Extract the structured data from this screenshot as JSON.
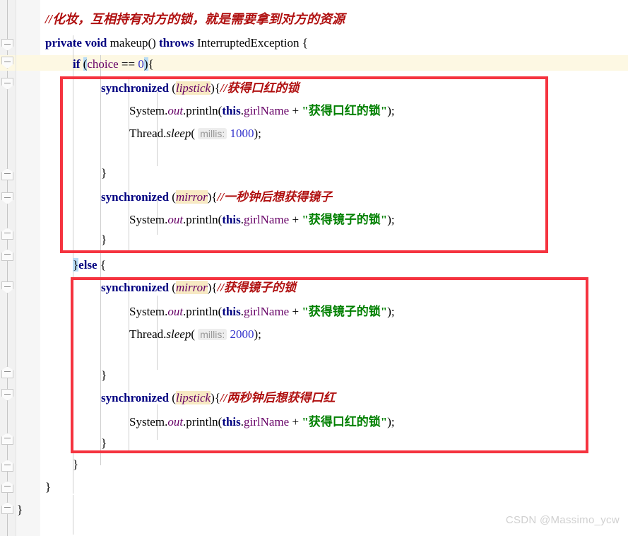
{
  "app": {
    "kind": "code-editor",
    "language": "Java",
    "theme": "light"
  },
  "watermark": {
    "text": "CSDN @Massimo_ycw"
  },
  "colors": {
    "annotation_box": "#f5333f",
    "current_line": "#fdf8e3",
    "keyword": "#000080",
    "comment": "#b01010",
    "string": "#008000",
    "number": "#3333cc",
    "field": "#660066",
    "identifier_highlight": "#f7e9c3",
    "brace_highlight": "#b8dcf5",
    "gutter": "#f1f1f1",
    "param_hint_bg": "#ededed",
    "param_hint_fg": "#999999",
    "watermark": "#d0d0d0"
  },
  "code": {
    "lines": [
      {
        "id": "line-comment-makeup",
        "indent": 1,
        "text": "//化妆，互相持有对方的锁，就是需要拿到对方的资源"
      },
      {
        "id": "line-method-signature",
        "indent": 0,
        "text": "private void makeup() throws InterruptedException {"
      },
      {
        "id": "line-if-choice",
        "indent": 1,
        "text": "if (choice == 0) {",
        "current": true
      },
      {
        "id": "line-sync-lipstick-1",
        "indent": 2,
        "text": "synchronized (lipstick){//获得口红的锁"
      },
      {
        "id": "line-println-lipstick-1",
        "indent": 3,
        "text": "System.out.println(this.girlName + \"获得口红的锁\");"
      },
      {
        "id": "line-sleep-1000",
        "indent": 3,
        "text": "Thread.sleep( millis: 1000);"
      },
      {
        "id": "line-close-brace-1",
        "indent": 2,
        "text": "}"
      },
      {
        "id": "line-sync-mirror-1",
        "indent": 2,
        "text": "synchronized (mirror){//一秒钟后想获得镜子"
      },
      {
        "id": "line-println-mirror-1",
        "indent": 3,
        "text": "System.out.println(this.girlName + \"获得镜子的锁\");"
      },
      {
        "id": "line-close-brace-2",
        "indent": 2,
        "text": "}"
      },
      {
        "id": "line-else",
        "indent": 1,
        "text": "}else {"
      },
      {
        "id": "line-sync-mirror-2",
        "indent": 2,
        "text": "synchronized (mirror){//获得镜子的锁"
      },
      {
        "id": "line-println-mirror-2",
        "indent": 3,
        "text": "System.out.println(this.girlName + \"获得镜子的锁\");"
      },
      {
        "id": "line-sleep-2000",
        "indent": 3,
        "text": "Thread.sleep( millis: 2000);"
      },
      {
        "id": "line-close-brace-3",
        "indent": 2,
        "text": "}"
      },
      {
        "id": "line-sync-lipstick-2",
        "indent": 2,
        "text": "synchronized (lipstick){//两秒钟后想获得口红"
      },
      {
        "id": "line-println-lipstick-2",
        "indent": 3,
        "text": "System.out.println(this.girlName + \"获得口红的锁\");"
      },
      {
        "id": "line-close-brace-4",
        "indent": 2,
        "text": "}"
      },
      {
        "id": "line-close-brace-5",
        "indent": 1,
        "text": "}"
      },
      {
        "id": "line-close-brace-6",
        "indent": 0,
        "text": "}"
      },
      {
        "id": "line-close-brace-7",
        "indent": 0,
        "text": "}"
      }
    ],
    "tokens": {
      "comment_makeup": "//化妆，互相持有对方的锁，就是需要拿到对方的资源",
      "kw_private": "private",
      "kw_void": "void",
      "method_makeup": "makeup()",
      "kw_throws": "throws",
      "type_interrupted": "InterruptedException",
      "brace_open": "{",
      "brace_close": "}",
      "kw_if": "if",
      "paren_open": "(",
      "paren_close": ")",
      "field_choice": "choice",
      "op_eq": "==",
      "num_zero": "0",
      "kw_synchronized": "synchronized",
      "var_lipstick": "lipstick",
      "var_mirror": "mirror",
      "comment_get_lipstick_lock": "//获得口红的锁",
      "comment_after_one_sec": "//一秒钟后想获得镜子",
      "comment_get_mirror_lock": "//获得镜子的锁",
      "comment_after_two_sec": "//两秒钟后想获得口红",
      "cls_system": "System",
      "fld_out": "out",
      "m_println": "println",
      "kw_this": "this",
      "fld_girlname": "girlName",
      "op_plus": "+",
      "str_lipstick_lock": "\"获得口红的锁\"",
      "str_mirror_lock": "\"获得镜子的锁\"",
      "cls_thread": "Thread",
      "m_sleep": "sleep",
      "hint_millis": "millis:",
      "num_1000": "1000",
      "num_2000": "2000",
      "kw_else": "else",
      "semicolon": ";"
    }
  },
  "annotations": {
    "boxes": [
      {
        "id": "redbox-if-branch",
        "label": "if-branch-highlight"
      },
      {
        "id": "redbox-else-branch",
        "label": "else-branch-highlight"
      }
    ]
  },
  "gutter": {
    "fold_markers": [
      {
        "id": "fold-0",
        "type": "expanded"
      },
      {
        "id": "fold-1",
        "type": "expanded"
      },
      {
        "id": "fold-2",
        "type": "expanded"
      },
      {
        "id": "fold-3",
        "type": "house"
      },
      {
        "id": "fold-4",
        "type": "expanded"
      },
      {
        "id": "fold-5",
        "type": "house"
      },
      {
        "id": "fold-6",
        "type": "house"
      },
      {
        "id": "fold-7",
        "type": "expanded"
      },
      {
        "id": "fold-8",
        "type": "house"
      },
      {
        "id": "fold-9",
        "type": "expanded"
      },
      {
        "id": "fold-10",
        "type": "house"
      },
      {
        "id": "fold-11",
        "type": "house"
      },
      {
        "id": "fold-12",
        "type": "house"
      },
      {
        "id": "fold-13",
        "type": "house"
      }
    ]
  }
}
